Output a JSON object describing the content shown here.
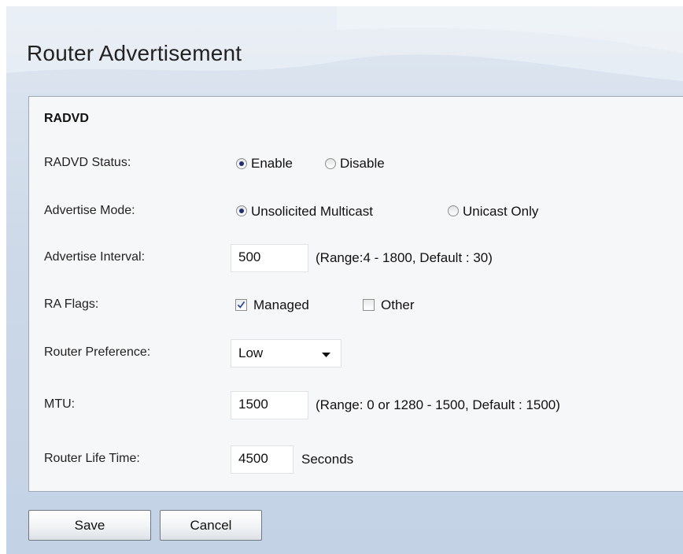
{
  "header": {
    "title": "Router Advertisement"
  },
  "section": {
    "title": "RADVD"
  },
  "fields": {
    "status": {
      "label": "RADVD Status:",
      "options": [
        "Enable",
        "Disable"
      ],
      "selected": "Enable"
    },
    "mode": {
      "label": "Advertise Mode:",
      "options": [
        "Unsolicited Multicast",
        "Unicast Only"
      ],
      "selected": "Unsolicited Multicast"
    },
    "interval": {
      "label": "Advertise Interval:",
      "value": "500",
      "hint": "(Range:4 - 1800, Default : 30)"
    },
    "flags": {
      "label": "RA Flags:",
      "managed": {
        "label": "Managed",
        "checked": true
      },
      "other": {
        "label": "Other",
        "checked": false
      }
    },
    "preference": {
      "label": "Router Preference:",
      "value": "Low"
    },
    "mtu": {
      "label": "MTU:",
      "value": "1500",
      "hint": "(Range: 0 or 1280 - 1500, Default : 1500)"
    },
    "lifetime": {
      "label": "Router Life Time:",
      "value": "4500",
      "unit": "Seconds"
    }
  },
  "buttons": {
    "save": "Save",
    "cancel": "Cancel"
  },
  "icons": {
    "dropdown": "chevron-down-icon",
    "check": "check-icon"
  },
  "colors": {
    "background": "#cdd9e8",
    "panel": "#f6f7f8",
    "radio_dot": "#1f2f6f",
    "checkmark": "#2b4c9b"
  }
}
